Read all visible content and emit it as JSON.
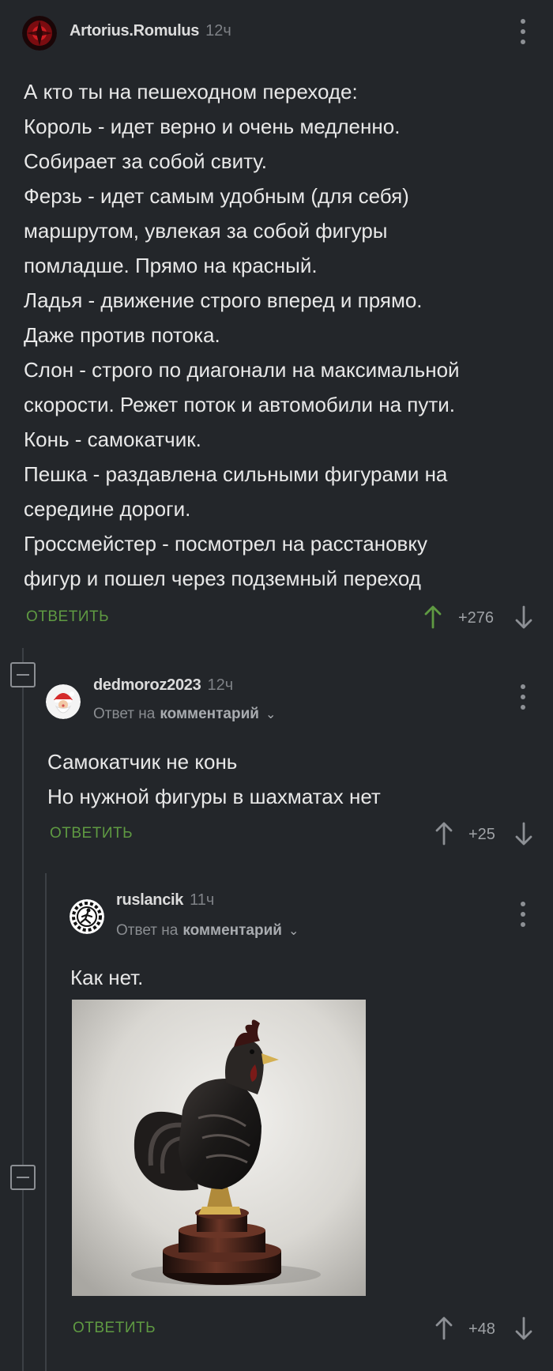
{
  "comment1": {
    "author": "Artorius.Romulus",
    "time": "12ч",
    "lines": [
      "А кто ты на пешеходном переходе:",
      "Король - идет верно и очень медленно.",
      "Собирает за собой свиту.",
      "Ферзь - идет самым удобным (для себя)",
      "маршрутом, увлекая за собой фигуры",
      "помладше. Прямо на красный.",
      "Ладья - движение строго вперед и прямо.",
      "Даже против потока.",
      "Слон - строго по диагонали на максимальной",
      "скорости. Режет поток и автомобили на пути.",
      "Конь - самокатчик.",
      "Пешка - раздавлена сильными фигурами на",
      "середине дороги.",
      "Гроссмейстер - посмотрел на расстановку",
      "фигур и пошел через подземный переход"
    ],
    "reply_label": "ОТВЕТИТЬ",
    "score": "+276"
  },
  "comment2": {
    "author": "dedmoroz2023",
    "time": "12ч",
    "reply_to_prefix": "Ответ на",
    "reply_to_link": "комментарий",
    "lines": [
      "Самокатчик не конь",
      "Но нужной фигуры в шахматах нет"
    ],
    "reply_label": "ОТВЕТИТЬ",
    "score": "+25"
  },
  "comment3": {
    "author": "ruslancik",
    "time": "11ч",
    "reply_to_prefix": "Ответ на",
    "reply_to_link": "комментарий",
    "text": "Как нет.",
    "image_icon": "rooster-chess-piece-photo",
    "reply_label": "ОТВЕТИТЬ",
    "score": "+48"
  },
  "colors": {
    "background": "#23262a",
    "reply_green": "#5f9a42",
    "upvote_active": "#5f9a42"
  }
}
